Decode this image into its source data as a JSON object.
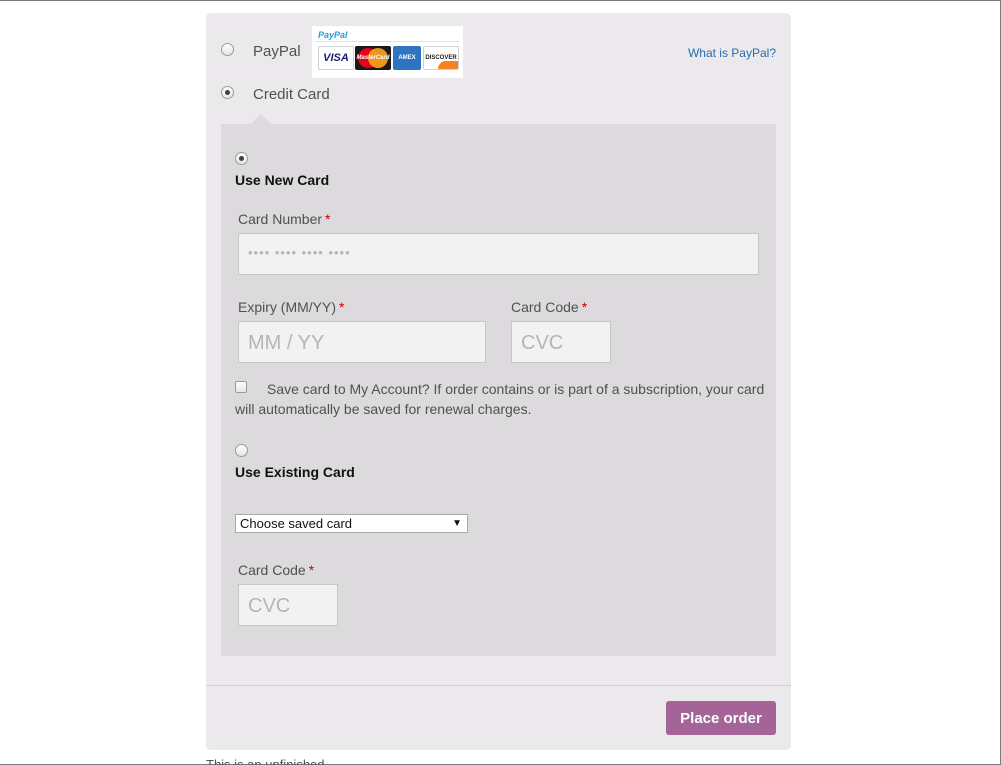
{
  "payment_methods": {
    "paypal": {
      "label": "PayPal",
      "selected": false,
      "logo_text": "PayPal",
      "card_logos": [
        "VISA",
        "MasterCard",
        "AMEX",
        "DISCOVER"
      ],
      "help_link": "What is PayPal?"
    },
    "credit_card": {
      "label": "Credit Card",
      "selected": true
    }
  },
  "new_card": {
    "title": "Use New Card",
    "selected": true,
    "card_number": {
      "label": "Card Number",
      "required_mark": "*",
      "placeholder": "•••• •••• •••• ••••"
    },
    "expiry": {
      "label": "Expiry (MM/YY)",
      "required_mark": "*",
      "placeholder": "MM / YY"
    },
    "card_code": {
      "label": "Card Code",
      "required_mark": "*",
      "placeholder": "CVC"
    },
    "save_card": {
      "checked": false,
      "text": "Save card to My Account? If order contains or is part of a subscription, your card will automatically be saved for renewal charges."
    }
  },
  "existing_card": {
    "title": "Use Existing Card",
    "selected": false,
    "select_value": "Choose saved card",
    "card_code": {
      "label": "Card Code",
      "required_mark": "*",
      "placeholder": "CVC"
    }
  },
  "actions": {
    "place_order": "Place order"
  },
  "colors": {
    "accent": "#a46497",
    "link": "#2b6cb0",
    "required": "#c80000",
    "panel": "#dcdadc",
    "box": "#ebe9eb"
  },
  "footer_text": "This is an unfinished..."
}
